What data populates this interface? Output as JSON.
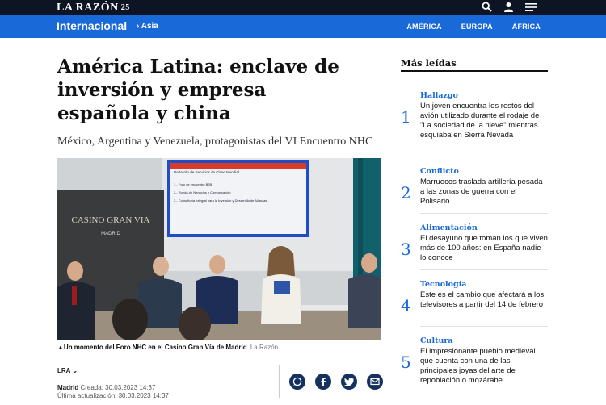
{
  "header": {
    "logo_text": "LA RAZÓN",
    "logo_badge": "25",
    "icons": [
      "search-icon",
      "user-icon",
      "menu-icon"
    ]
  },
  "section": {
    "title": "Internacional",
    "crumb": "› Asia",
    "regions": [
      "AMÉRICA",
      "EUROPA",
      "ÁFRICA"
    ]
  },
  "article": {
    "headline": "América Latina: enclave de inversión y empresa española y china",
    "subhead": "México, Argentina y Venezuela, protagonistas del VI Encuentro NHC",
    "image": {
      "screen_title": "Portafolio de Servicios de Clase Mundial",
      "screen_lines": [
        "1.- Foro de encuentro B2B",
        "2.- Rueda de Negocios y Comunicación",
        "3.- Consultoría Integral para la Inversión y Desarrollo de Alianzas"
      ],
      "banner_text": "CASINO GRAN VIA",
      "banner_sub": "MADRID"
    },
    "caption_main": "▲Un momento del Foro NHC en el Casino Gran Vía de Madrid",
    "caption_credit": "La Razón",
    "author": "LRA",
    "meta": {
      "place": "Madrid",
      "created": "Creada: 30.03.2023 14:37",
      "updated": "Última actualización: 30.03.2023 14:37"
    },
    "share_icons": [
      "whatsapp-icon",
      "facebook-icon",
      "twitter-icon",
      "email-icon"
    ]
  },
  "sidebar": {
    "title": "Más leídas",
    "items": [
      {
        "num": "1",
        "cat": "Hallazgo",
        "text": "Un joven encuentra los restos del avión utilizado durante el rodaje de \"La sociedad de la nieve\" mientras esquiaba en Sierra Nevada"
      },
      {
        "num": "2",
        "cat": "Conflicto",
        "text": "Marruecos traslada artillería pesada a las zonas de guerra con el Polisario"
      },
      {
        "num": "3",
        "cat": "Alimentación",
        "text": "El desayuno que toman los que viven más de 100 años: en España nadie lo conoce"
      },
      {
        "num": "4",
        "cat": "Tecnología",
        "text": "Este es el cambio que afectará a los televisores a partir del 14 de febrero"
      },
      {
        "num": "5",
        "cat": "Cultura",
        "text": "El impresionante pueblo medieval que cuenta con una de las principales joyas del arte de repoblación o mozárabe"
      }
    ]
  },
  "colors": {
    "topbar": "#0d1524",
    "accent": "#1a69d8",
    "share_button": "#14315f"
  }
}
